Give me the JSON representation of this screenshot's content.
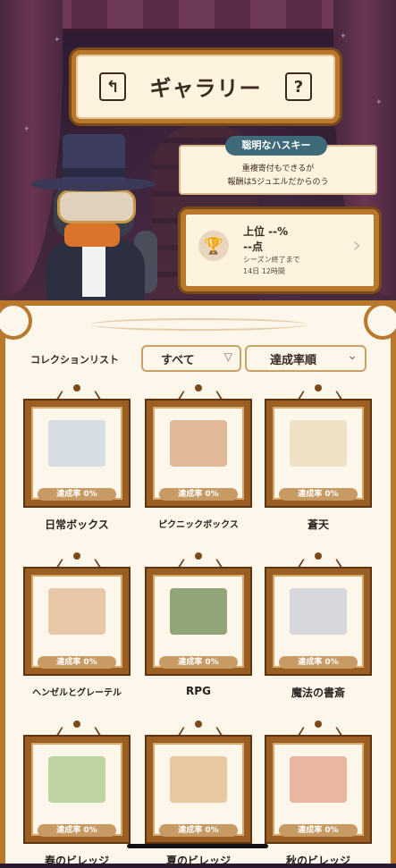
{
  "header": {
    "title": "ギャラリー",
    "back_icon": "↰",
    "help_icon": "?"
  },
  "npc": {
    "name": "聡明なハスキー",
    "line1": "重複寄付もできるが",
    "line2": "報酬は5ジュエルだからのう"
  },
  "ranking": {
    "rank": "上位 --%",
    "points": "--点",
    "label": "シーズン終了まで",
    "time_left": "14日 12時間",
    "icon": "trophy-icon"
  },
  "filters": {
    "collection_label": "コレクションリスト",
    "filter_value": "すべて",
    "sort_value": "達成率順"
  },
  "items": [
    {
      "name": "日常ボックス",
      "rate": "達成率 0%",
      "art_color": "#c8d4e0"
    },
    {
      "name": "ピクニックボックス",
      "rate": "達成率 0%",
      "art_color": "#d8a47a"
    },
    {
      "name": "蒼天",
      "rate": "達成率 0%",
      "art_color": "#ead9b8"
    },
    {
      "name": "ヘンゼルとグレーテル",
      "rate": "達成率 0%",
      "art_color": "#e0b890"
    },
    {
      "name": "RPG",
      "rate": "達成率 0%",
      "art_color": "#6d8a52"
    },
    {
      "name": "魔法の書斎",
      "rate": "達成率 0%",
      "art_color": "#c9ccd8"
    },
    {
      "name": "春のビレッジ",
      "rate": "達成率 0%",
      "art_color": "#a8c88a"
    },
    {
      "name": "夏のビレッジ",
      "rate": "達成率 0%",
      "art_color": "#e0b884"
    },
    {
      "name": "秋のビレッジ",
      "rate": "達成率 0%",
      "art_color": "#e0a088"
    }
  ]
}
